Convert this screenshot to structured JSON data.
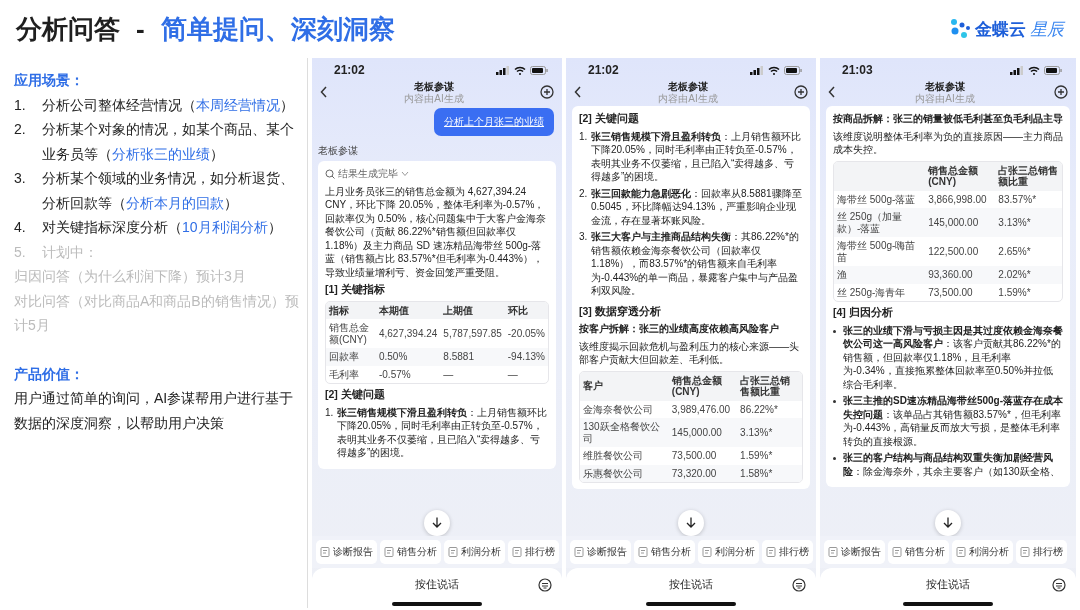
{
  "slide": {
    "title": "分析问答",
    "dash": "-",
    "subtitle": "简单提问、深刻洞察",
    "logo": {
      "name": "金蝶云",
      "product": "星辰"
    }
  },
  "scenarios": {
    "heading": "应用场景：",
    "items": [
      {
        "number": "1.",
        "text": "分析公司整体经营情况（",
        "link": "本周经营情况",
        "tail": "）",
        "planned": false
      },
      {
        "number": "2.",
        "text": "分析某个对象的情况，如某个商品、某个业务员等（",
        "link": "分析张三的业绩",
        "tail": "）",
        "planned": false
      },
      {
        "number": "3.",
        "text": "分析某个领域的业务情况，如分析退货、分析回款等（",
        "link": "分析本月的回款",
        "tail": "）",
        "planned": false
      },
      {
        "number": "4.",
        "text": "对关键指标深度分析（",
        "link": "10月利润分析",
        "tail": "）",
        "planned": false
      },
      {
        "number": "5.",
        "text": "计划中：",
        "planned": true
      }
    ],
    "notes": [
      "归因问答（为什么利润下降）预计3月",
      "对比问答（对比商品A和商品B的销售情况）预计5月"
    ]
  },
  "value": {
    "heading": "产品价值：",
    "text": "用户通过简单的询问，AI参谋帮用户进行基于数据的深度洞察，以帮助用户决策"
  },
  "phones": [
    {
      "time": "21:02",
      "title": "老板参谋",
      "subtitle": "内容由AI生成",
      "blocks": [
        {
          "kind": "user_message",
          "text": "分析上个月张三的业绩"
        },
        {
          "kind": "sender",
          "text": "老板参谋"
        },
        {
          "kind": "card",
          "status": "结果生成完毕",
          "blocks": [
            {
              "kind": "paragraph",
              "text": "上月业务员张三的销售总金额为 4,627,394.24 CNY，环比下降 20.05%，整体毛利率为-0.57%，回款率仅为 0.50%，核心问题集中于大客户金海奈餐饮公司（贡献 86.22%*销售额但回款率仅 1.18%）及主力商品 SD 速冻精品海带丝 500g-落蓝（销售额占比 83.57%*但毛利率为-0.443%），导致业绩量增利亏、资金回笼严重受阻。"
            },
            {
              "kind": "heading",
              "text": "[1] 关键指标"
            },
            {
              "kind": "table",
              "columns": [
                "指标",
                "本期值",
                "上期值",
                "环比"
              ],
              "rows": [
                [
                  "销售总金额(CNY)",
                  "4,627,394.24",
                  "5,787,597.85",
                  "-20.05%"
                ],
                [
                  "回款率",
                  "0.50%",
                  "8.5881",
                  "-94.13%"
                ],
                [
                  "毛利率",
                  "-0.57%",
                  "—",
                  "—"
                ]
              ]
            },
            {
              "kind": "heading",
              "text": "[2] 关键问题"
            },
            {
              "kind": "numbered",
              "items": [
                {
                  "number": "1.",
                  "text": "**张三销售规模下滑且盈利转负**：上月销售额环比下降20.05%，同时毛利率由正转负至-0.57%，表明其业务不仅萎缩，且已陷入“卖得越多、亏得越多”的困境。"
                }
              ]
            }
          ]
        }
      ],
      "actions": [
        "诊断报告",
        "销售分析",
        "利润分析",
        "排行榜"
      ],
      "voice": "按住说话"
    },
    {
      "time": "21:02",
      "title": "老板参谋",
      "subtitle": "内容由AI生成",
      "blocks": [
        {
          "kind": "card",
          "blocks": [
            {
              "kind": "heading",
              "text": "[2] 关键问题"
            },
            {
              "kind": "numbered",
              "items": [
                {
                  "number": "1.",
                  "text": "**张三销售规模下滑且盈利转负**：上月销售额环比下降20.05%，同时毛利率由正转负至-0.57%，表明其业务不仅萎缩，且已陷入“卖得越多、亏得越多”的困境。"
                },
                {
                  "number": "2.",
                  "text": "**张三回款能力急剧恶化**：回款率从8.5881骤降至0.5045，环比降幅达94.13%，严重影响企业现金流，存在显著坏账风险。"
                },
                {
                  "number": "3.",
                  "text": "**张三大客户与主推商品结构失衡**：其86.22%*的销售额依赖金海奈餐饮公司（回款率仅1.18%），而83.57%*的销售额来自毛利率为-0.443%的单一商品，暴露客户集中与产品盈利双风险。"
                }
              ]
            },
            {
              "kind": "heading",
              "text": "[3] 数据穿透分析"
            },
            {
              "kind": "subheading",
              "text": "按客户拆解：张三的业绩高度依赖高风险客户"
            },
            {
              "kind": "paragraph",
              "text": "该维度揭示回款危机与盈利压力的核心来源——头部客户贡献大但回款差、毛利低。"
            },
            {
              "kind": "table",
              "columns": [
                "客户",
                "销售总金额(CNY)",
                "占张三总销售额比重"
              ],
              "rows": [
                [
                  "金海奈餐饮公司",
                  "3,989,476.00",
                  "86.22%*"
                ],
                [
                  "130跃全格餐饮公司",
                  "145,000.00",
                  "3.13%*"
                ],
                [
                  "维胜餐饮公司",
                  "73,500.00",
                  "1.59%*"
                ],
                [
                  "乐惠餐饮公司",
                  "73,320.00",
                  "1.58%*"
                ]
              ]
            }
          ]
        }
      ],
      "actions": [
        "诊断报告",
        "销售分析",
        "利润分析",
        "排行榜"
      ],
      "voice": "按住说话"
    },
    {
      "time": "21:03",
      "title": "老板参谋",
      "subtitle": "内容由AI生成",
      "blocks": [
        {
          "kind": "card",
          "blocks": [
            {
              "kind": "subheading",
              "text": "按商品拆解：张三的销量被低毛利甚至负毛利品主导"
            },
            {
              "kind": "paragraph",
              "text": "该维度说明整体毛利率为负的直接原因——主力商品成本失控。"
            },
            {
              "kind": "table",
              "columns": [
                "",
                "销售总金额(CNY)",
                "占张三总销售额比重"
              ],
              "rows": [
                [
                  "海带丝 500g-落蓝",
                  "3,866,998.00",
                  "83.57%*"
                ],
                [
                  "丝 250g（加量款）-落蓝",
                  "145,000.00",
                  "3.13%*"
                ],
                [
                  "海带丝 500g-嗨苗苗",
                  "122,500.00",
                  "2.65%*"
                ],
                [
                  "渔",
                  "93,360.00",
                  "2.02%*"
                ],
                [
                  "丝 250g-海青年",
                  "73,500.00",
                  "1.59%*"
                ]
              ]
            },
            {
              "kind": "heading",
              "text": "[4] 归因分析"
            },
            {
              "kind": "bullets",
              "items": [
                "**张三的业绩下滑与亏损主因是其过度依赖金海奈餐饮公司这一高风险客户**：该客户贡献其86.22%*的销售额，但回款率仅1.18%，且毛利率为-0.34%，直接拖累整体回款率至0.50%并拉低综合毛利率。",
                "**张三主推的SD速冻精品海带丝500g-落蓝存在成本失控问题**：该单品占其销售额83.57%*，但毛利率为-0.443%，高销量反而放大亏损，是整体毛利率转负的直接根源。",
                "**张三的客户结构与商品结构双重失衡加剧经营风险**：除金海奈外，其余主要客户（如130跃全格、"
              ]
            }
          ]
        }
      ],
      "actions": [
        "诊断报告",
        "销售分析",
        "利润分析",
        "排行榜"
      ],
      "voice": "按住说话"
    }
  ]
}
